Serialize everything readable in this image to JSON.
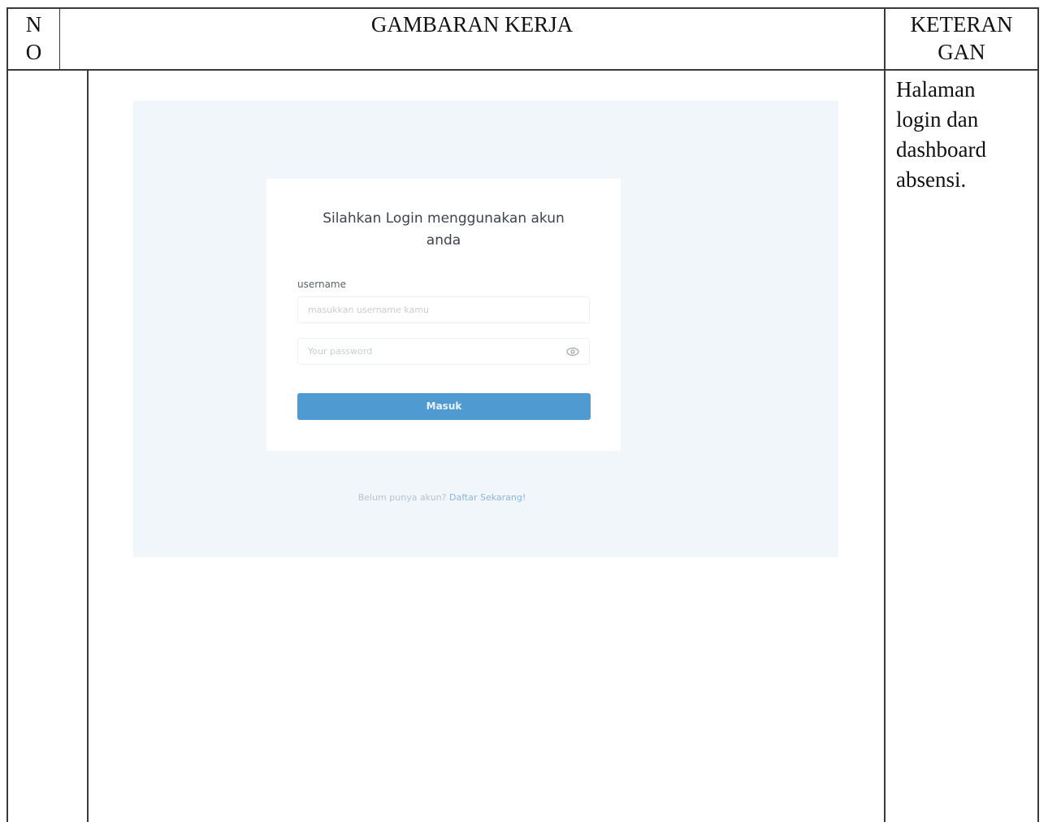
{
  "table": {
    "header": {
      "no": "NO",
      "no_line1": "N",
      "no_line2": "O",
      "gambaran": "GAMBARAN KERJA",
      "keterangan": "KETERANGAN",
      "keterangan_line1": "KETERAN",
      "keterangan_line2": "GAN"
    },
    "rows": [
      {
        "no": "",
        "keterangan_lines": [
          "Halaman",
          "login dan",
          "dashboard",
          "absensi."
        ]
      }
    ]
  },
  "login": {
    "title_line1": "Silahkan Login menggunakan akun",
    "title_line2": "anda",
    "username_label": "username",
    "username_placeholder": "masukkan username kamu",
    "password_placeholder": "Your password",
    "password_toggle_icon": "eye-icon",
    "submit_label": "Masuk",
    "signup_prompt": "Belum punya akun?",
    "signup_link": "Daftar Sekarang!"
  },
  "colors": {
    "background": "#f1f6fa",
    "button": "#4e9ad1",
    "link": "#8bb6d8"
  }
}
